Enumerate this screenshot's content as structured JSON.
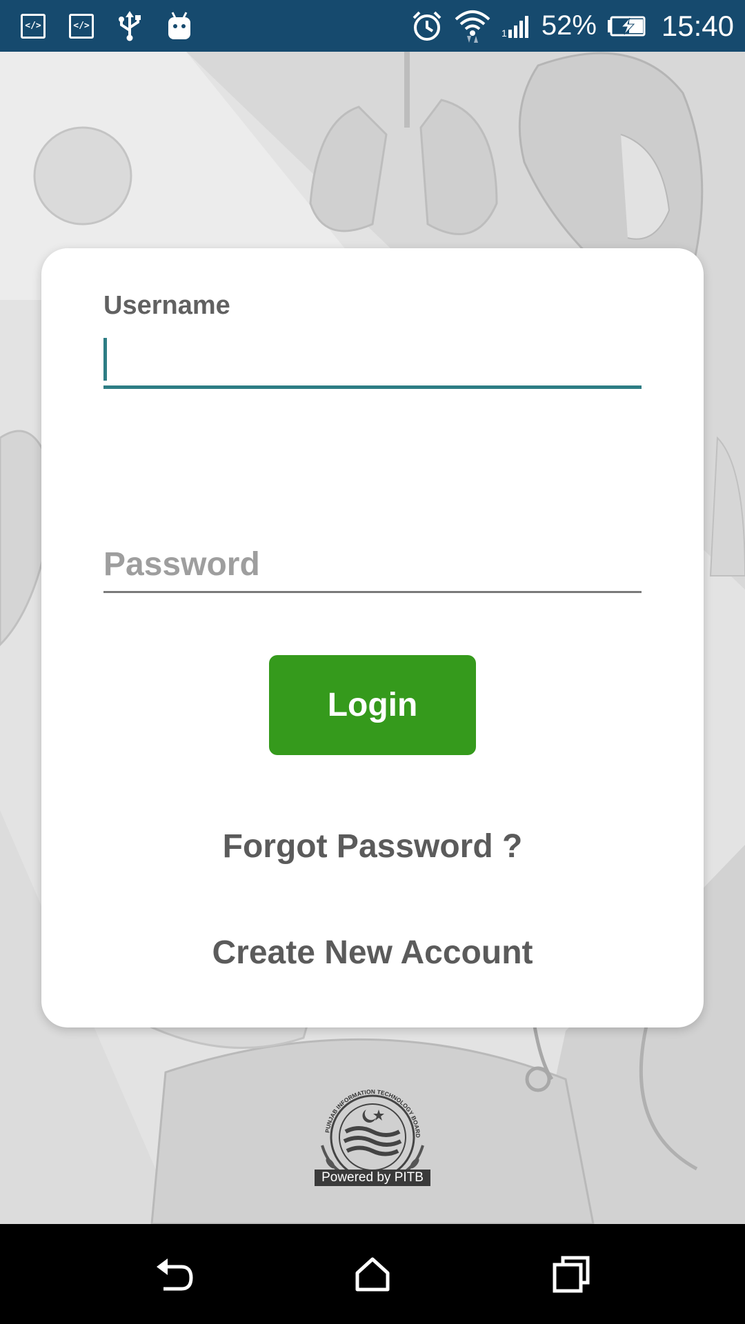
{
  "status_bar": {
    "battery": "52%",
    "time": "15:40",
    "icons": [
      "code-icon",
      "code-icon",
      "usb-icon",
      "android-icon",
      "alarm-icon",
      "wifi-icon",
      "signal-icon",
      "battery-charging-icon"
    ]
  },
  "login_form": {
    "username_label": "Username",
    "username_value": "",
    "password_placeholder": "Password",
    "login_label": "Login",
    "forgot_password_label": "Forgot Password ?",
    "create_account_label": "Create New Account"
  },
  "footer": {
    "logo_text": "PUNJAB INFORMATION TECHNOLOGY BOARD",
    "powered_by": "Powered by PITB"
  },
  "nav_bar": {
    "icons": [
      "back-icon",
      "home-icon",
      "recents-icon"
    ]
  },
  "colors": {
    "status_bar": "#164a6e",
    "accent": "#2e7d84",
    "login_button": "#359a1c",
    "link_text": "#5b5b5b"
  }
}
